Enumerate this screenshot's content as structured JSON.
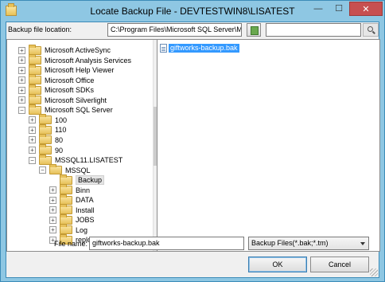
{
  "window": {
    "title": "Locate Backup File - DEVTESTWIN8\\LISATEST",
    "minimize_glyph": "—",
    "maximize_glyph": "☐",
    "close_glyph": "✕"
  },
  "location": {
    "label": "Backup file location:",
    "value": "C:\\Program Files\\Microsoft SQL Server\\MSSQ",
    "search_placeholder": ""
  },
  "tree": {
    "expanded_glyph": "−",
    "collapsed_glyph": "+",
    "items": [
      {
        "label": "Microsoft ActiveSync",
        "depth": 0,
        "state": "collapsed"
      },
      {
        "label": "Microsoft Analysis Services",
        "depth": 0,
        "state": "collapsed"
      },
      {
        "label": "Microsoft Help Viewer",
        "depth": 0,
        "state": "collapsed"
      },
      {
        "label": "Microsoft Office",
        "depth": 0,
        "state": "collapsed"
      },
      {
        "label": "Microsoft SDKs",
        "depth": 0,
        "state": "collapsed"
      },
      {
        "label": "Microsoft Silverlight",
        "depth": 0,
        "state": "collapsed"
      },
      {
        "label": "Microsoft SQL Server",
        "depth": 0,
        "state": "expanded"
      },
      {
        "label": "100",
        "depth": 1,
        "state": "collapsed"
      },
      {
        "label": "110",
        "depth": 1,
        "state": "collapsed"
      },
      {
        "label": "80",
        "depth": 1,
        "state": "collapsed"
      },
      {
        "label": "90",
        "depth": 1,
        "state": "collapsed"
      },
      {
        "label": "MSSQL11.LISATEST",
        "depth": 1,
        "state": "expanded"
      },
      {
        "label": "MSSQL",
        "depth": 2,
        "state": "expanded"
      },
      {
        "label": "Backup",
        "depth": 3,
        "state": "none",
        "selected": true
      },
      {
        "label": "Binn",
        "depth": 3,
        "state": "collapsed"
      },
      {
        "label": "DATA",
        "depth": 3,
        "state": "collapsed"
      },
      {
        "label": "Install",
        "depth": 3,
        "state": "collapsed"
      },
      {
        "label": "JOBS",
        "depth": 3,
        "state": "collapsed"
      },
      {
        "label": "Log",
        "depth": 3,
        "state": "collapsed"
      },
      {
        "label": "repldata",
        "depth": 3,
        "state": "collapsed"
      }
    ]
  },
  "files": [
    {
      "label": "giftworks-backup.bak",
      "selected": true
    }
  ],
  "filename": {
    "label": "File name:",
    "value": "giftworks-backup.bak"
  },
  "filetype": {
    "selected": "Backup Files(*.bak;*.tm)"
  },
  "buttons": {
    "ok": "OK",
    "cancel": "Cancel"
  }
}
